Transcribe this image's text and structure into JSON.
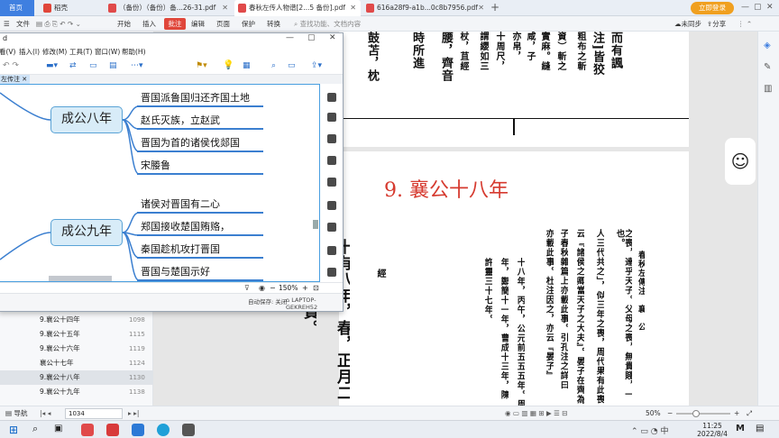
{
  "tabs": [
    {
      "label": "首页"
    },
    {
      "label": "稻壳"
    },
    {
      "label": "（备份）（备份）备...26-31.pdf"
    },
    {
      "label": "春秋左传人物谱[2...5 备份].pdf"
    },
    {
      "label": "616a28f9-a1b...0c8b7956.pdf"
    }
  ],
  "login_label": "立即登录",
  "ribbon": {
    "file": "文件",
    "start": "开始",
    "insert": "插入",
    "annotate": "批注",
    "edit": "编辑",
    "page": "页面",
    "protect": "保护",
    "convert": "转换",
    "search_placeholder": "查找功能、文档内容",
    "sync": "未同步",
    "share": "分享"
  },
  "mindmap": {
    "title": "d",
    "menu": [
      "看(V)",
      "插入(I)",
      "修改(M)",
      "工具(T)",
      "窗口(W)",
      "帮助(H)"
    ],
    "tab": "左传注",
    "nodes": [
      {
        "label": "成公八年",
        "leaves": [
          "晋国派鲁国归还齐国土地",
          "赵氏灭族，立赵武",
          "晋国为首的诸侯伐郯国",
          "宋媵鲁"
        ]
      },
      {
        "label": "成公九年",
        "leaves": [
          "诸侯对晋国有二心",
          "郑国接收楚国贿赂，",
          "秦国趁机攻打晋国",
          "晋国与楚国示好"
        ]
      }
    ],
    "zoom": "150%",
    "autosave": "自动保存: 关闭",
    "computer": "LAPTOP-GEKREH52"
  },
  "bookmarks": [
    {
      "title": "9.襄公十四年",
      "page": "1098"
    },
    {
      "title": "9.襄公十五年",
      "page": "1115"
    },
    {
      "title": "9.襄公十六年",
      "page": "1119"
    },
    {
      "title": "襄公十七年",
      "page": "1124"
    },
    {
      "title": "9.襄公十八年",
      "page": "1130",
      "selected": true
    },
    {
      "title": "9.襄公十九年",
      "page": "1138"
    }
  ],
  "pdf": {
    "heading": "9. 襄公十八年",
    "top_cols": [
      "而有諷",
      "注]皆狡",
      "粗布之斬",
      "資）斬之",
      "實麻。縫",
      "咸，子",
      "亦帛，",
      "十周尺，",
      "謂纓如三",
      "杖，苴經",
      "腰，齊音",
      "時所進",
      "鼓苫，枕"
    ],
    "cols": [
      "春秋左傳注　襄　公",
      "之喪，達乎天子。父母之喪，無貴賤，一也。",
      "人三代共之」，似三年之喪，周代果有此喪",
      "云『諸侯之卿當天子之大夫』。晏子在齊為",
      "子春秋雜篇上亦載此事。引孔注之詳曰",
      "亦載此事。杜注因之，亦云『晏子』",
      "十八年，丙午，公元前五五五年。周",
      "年，鄭簡十一年，曹成十三年，陳",
      "許靈三十七年。"
    ],
    "left_cols": [
      "十有八年，春，正月二十七日戊",
      "衛行人石買。"
    ],
    "small_col": "經"
  },
  "status": {
    "nav": "导航",
    "page_info": "1034 (1130/1834)",
    "zoom": "50%"
  },
  "taskbar": {
    "time": "11:25",
    "date": "2022/8/4"
  }
}
